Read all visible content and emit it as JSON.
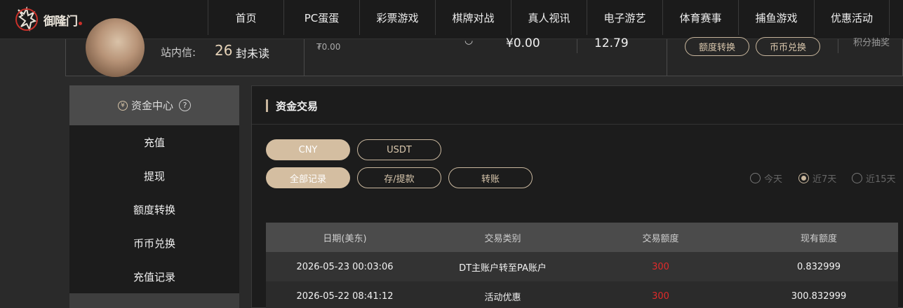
{
  "logo": {
    "text": "御隆门"
  },
  "nav": [
    "首页",
    "PC蛋蛋",
    "彩票游戏",
    "棋牌对战",
    "真人视讯",
    "电子游艺",
    "体育赛事",
    "捕鱼游戏",
    "优惠活动"
  ],
  "userinfo": {
    "inbox_label": "站内信:",
    "inbox_count": "26",
    "inbox_unread": "封未读",
    "balance_1": "₮0.00",
    "balance_2": "¥0.00",
    "balance_3": "12.79",
    "transfer_label": "额度转换",
    "exchange_label": "币币兑换",
    "points_label": "积分抽奖"
  },
  "sidebar": {
    "title": "资金中心",
    "items": [
      "充值",
      "提现",
      "额度转换",
      "币币兑换",
      "充值记录"
    ]
  },
  "panel": {
    "title": "资金交易",
    "currency_tabs": [
      "CNY",
      "USDT"
    ],
    "type_tabs": [
      "全部记录",
      "存/提款",
      "转账"
    ],
    "range_options": [
      "今天",
      "近7天",
      "近15天"
    ],
    "selected_range": "近7天",
    "columns": [
      "日期(美东)",
      "交易类别",
      "交易额度",
      "现有额度"
    ],
    "rows": [
      {
        "date": "2026-05-23 00:03:06",
        "type": "DT主账户转至PA账户",
        "amount": "300",
        "balance": "0.832999"
      },
      {
        "date": "2026-05-22 08:41:12",
        "type": "活动优惠",
        "amount": "300",
        "balance": "300.832999"
      }
    ]
  },
  "colors": {
    "accent": "#d4bea1",
    "amount_red": "#e02a2a"
  }
}
